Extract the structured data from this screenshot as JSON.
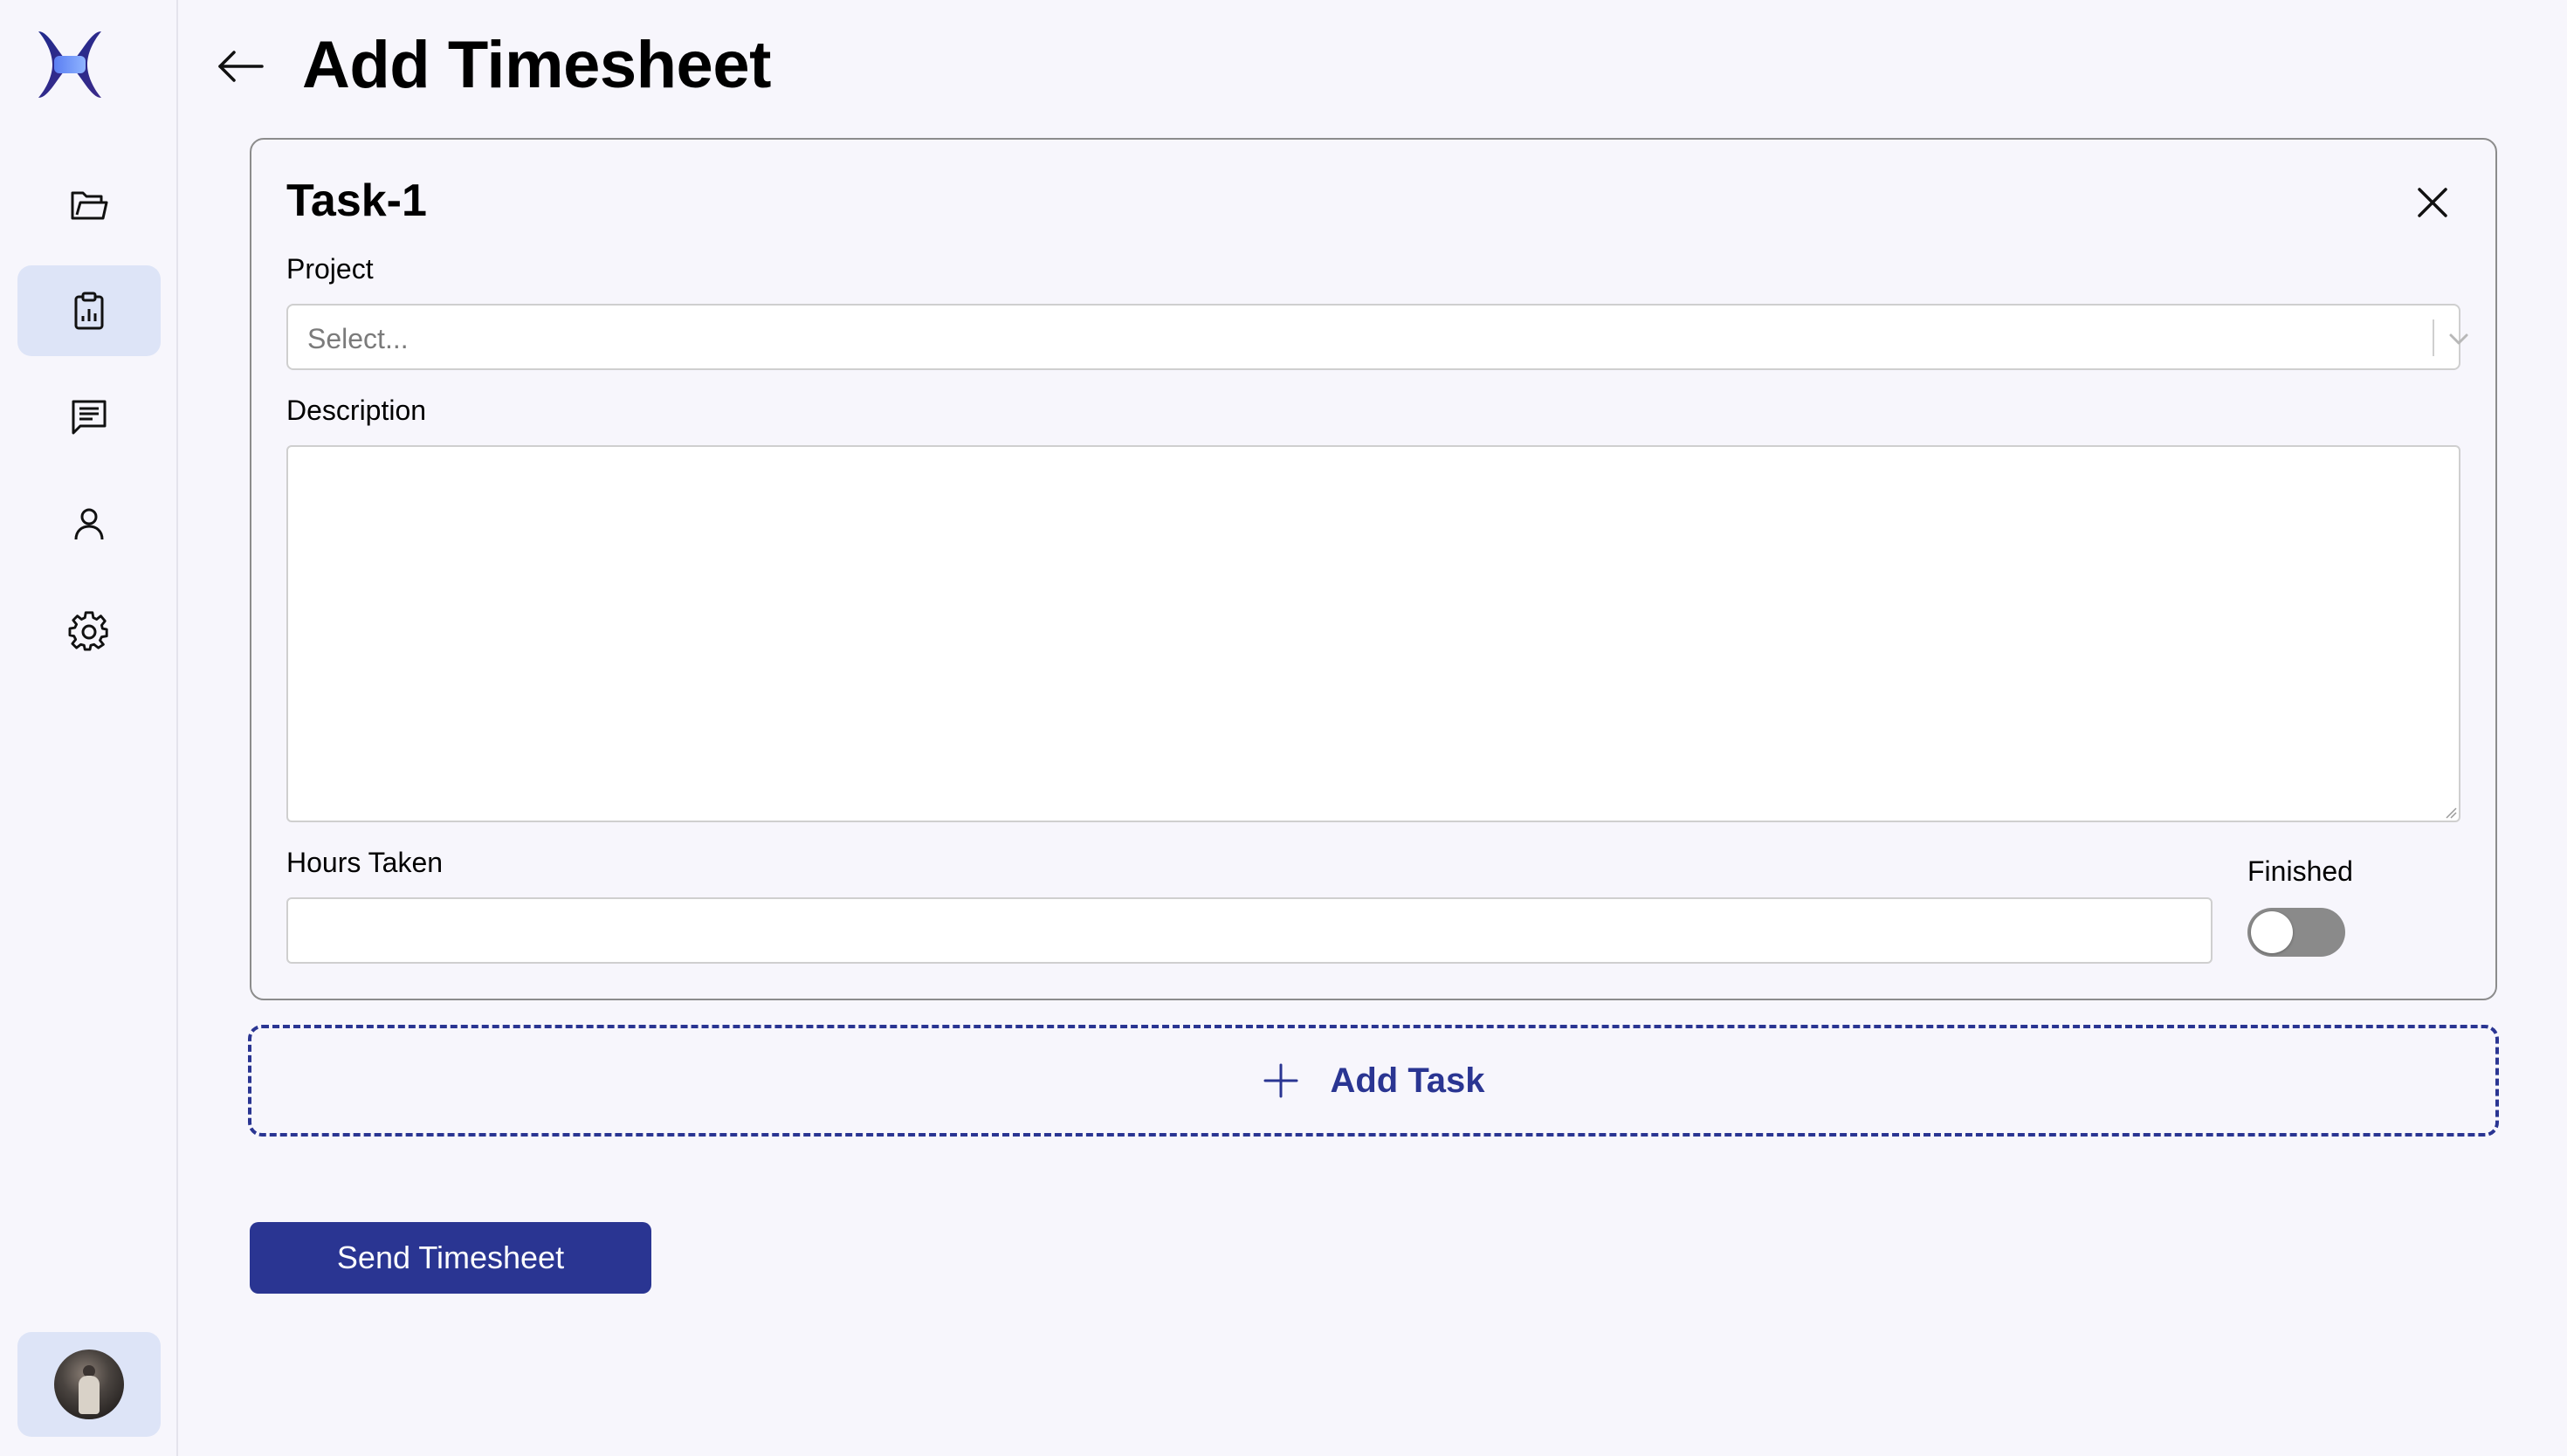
{
  "page": {
    "title": "Add Timesheet"
  },
  "sidebar": {
    "items": [
      {
        "name": "folder-icon",
        "active": false
      },
      {
        "name": "clipboard-chart-icon",
        "active": true
      },
      {
        "name": "message-icon",
        "active": false
      },
      {
        "name": "user-icon",
        "active": false
      },
      {
        "name": "gear-icon",
        "active": false
      }
    ]
  },
  "task": {
    "title": "Task-1",
    "project_label": "Project",
    "project_placeholder": "Select...",
    "description_label": "Description",
    "description_value": "",
    "hours_label": "Hours Taken",
    "hours_value": "",
    "finished_label": "Finished",
    "finished": false
  },
  "actions": {
    "add_task_label": "Add Task",
    "send_label": "Send Timesheet"
  },
  "colors": {
    "accent": "#2a3592",
    "background": "#f7f6fc",
    "active_nav": "#dde4f7",
    "toggle_off": "#8a8a8a"
  }
}
